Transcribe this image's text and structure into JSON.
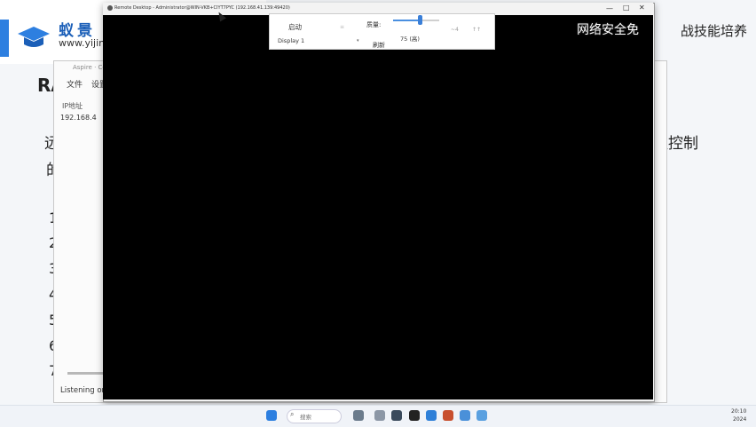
{
  "brand": {
    "name": "蚁景",
    "url": "www.yijing",
    "watermark": "网络安全免",
    "top_right": "战技能培养"
  },
  "slide": {
    "title": "RA",
    "line1_start": "远",
    "line1_end": "组控制",
    "line2_start": "的",
    "numbers": [
      "1",
      "2",
      "3",
      "4",
      "5",
      "6",
      "7"
    ]
  },
  "background_window": {
    "title": "Aspire · Control",
    "menu": {
      "file": "文件",
      "settings": "设置"
    },
    "column_header": "IP地址",
    "row_ip": "192.168.4",
    "status": "Listening on"
  },
  "remote_desktop": {
    "title": "Remote Desktop - Administrator@WIN-VKB+CIYT7PYC (192.168.41.139:49420)",
    "controls": {
      "minimize": "—",
      "maximize": "□",
      "close": "✕"
    },
    "toolbar": {
      "start_label": "启动",
      "display_select": "Display 1",
      "quality_label": "质量:",
      "quality_value": "75 (高)",
      "quality_level_percent": 55,
      "refresh_label": "刷新",
      "dim1": "≡",
      "dim2": "~4",
      "dim3": "↑↑"
    }
  },
  "taskbar": {
    "search_placeholder": "搜索",
    "clock_time": "20:10",
    "clock_date": "2024",
    "icons": [
      "windows-start-icon",
      "search-icon",
      "bike-app-icon",
      "chat-app-icon",
      "settings-gear-icon",
      "gallery-app-icon",
      "photos-app-icon",
      "cloud-app-icon",
      "shield-app-icon",
      "terminal-app-icon"
    ]
  },
  "colors": {
    "brand_blue": "#1b5fb8",
    "accent_blue": "#2d7fe0",
    "screen_black": "#000000"
  }
}
